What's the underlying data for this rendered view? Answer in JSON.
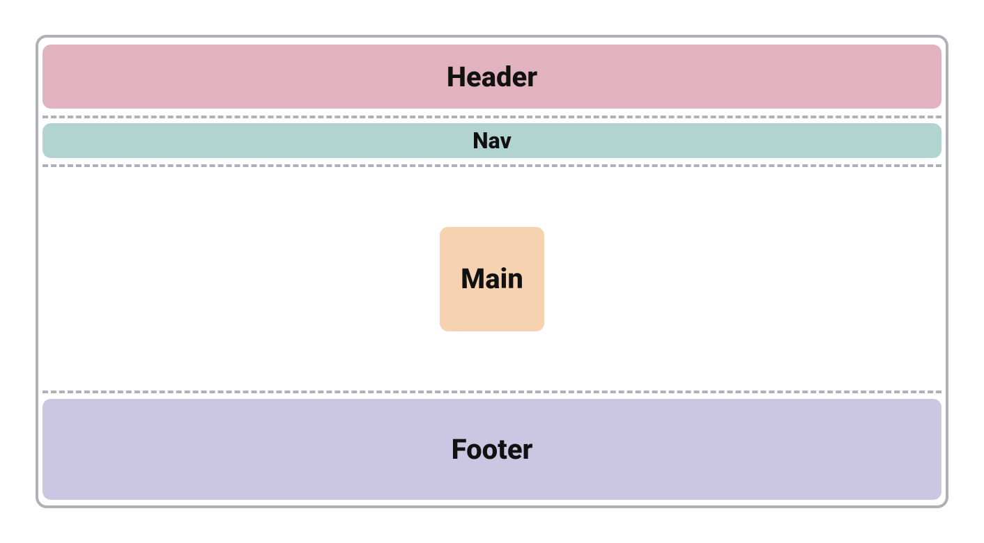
{
  "layout": {
    "header": {
      "label": "Header"
    },
    "nav": {
      "label": "Nav"
    },
    "main": {
      "label": "Main"
    },
    "footer": {
      "label": "Footer"
    }
  },
  "colors": {
    "border": "#b0b0b8",
    "header_bg": "#e1b2bf",
    "nav_bg": "#b1d4d0",
    "main_bg": "#f7d2b0",
    "footer_bg": "#cbc6e1"
  }
}
